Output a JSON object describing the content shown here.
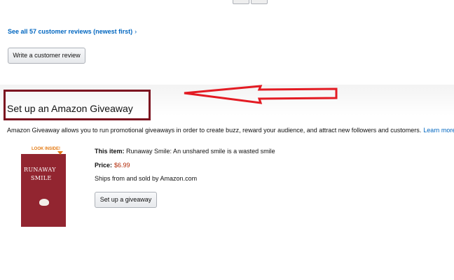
{
  "reviews": {
    "see_all_label": "See all 57 customer reviews (newest first)",
    "see_all_chevron": "›",
    "write_review_label": "Write a customer review"
  },
  "giveaway": {
    "title": "Set up an Amazon Giveaway",
    "description": "Amazon Giveaway allows you to run promotional giveaways in order to create buzz, reward your audience, and attract new followers and customers.",
    "learn_more": "Learn more",
    "item_label": "This item:",
    "item_value": "Runaway Smile: An unshared smile is a wasted smile",
    "price_label": "Price:",
    "price_value": "$6.99",
    "ships_text": "Ships from and sold by Amazon.com",
    "setup_button": "Set up a giveaway"
  },
  "book_cover": {
    "badge": "LOOK INSIDE!",
    "title_line1": "RUNAWAY",
    "title_line2": "SMILE"
  },
  "colors": {
    "link": "#0066c0",
    "price": "#b12704",
    "highlight_box": "#7c1320",
    "arrow": "#e31b23",
    "cover": "#922530"
  }
}
